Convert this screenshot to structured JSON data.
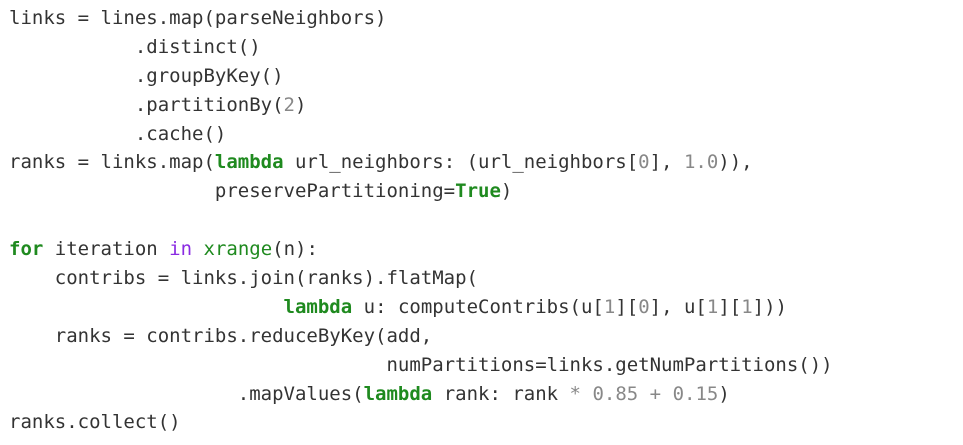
{
  "code": {
    "l1": {
      "a": "links = lines.map(parseNeighbors)"
    },
    "l2": {
      "a": "           .distinct()"
    },
    "l3": {
      "a": "           .groupByKey()"
    },
    "l4": {
      "a": "           .partitionBy(",
      "n": "2",
      "b": ")"
    },
    "l5": {
      "a": "           .cache()"
    },
    "l6": {
      "a": "ranks = links.map(",
      "k": "lambda",
      "b": " url_neighbors: (url_neighbors[",
      "n1": "0",
      "c": "], ",
      "n2": "1.0",
      "d": ")),"
    },
    "l7": {
      "a": "                  preservePartitioning=",
      "k": "True",
      "b": ")"
    },
    "l8": {
      "a": ""
    },
    "l9": {
      "k": "for",
      "a": " iteration ",
      "k2": "in",
      "b": " ",
      "f": "xrange",
      "c": "(n):"
    },
    "l10": {
      "a": "    contribs = links.join(ranks).flatMap("
    },
    "l11": {
      "a": "                        ",
      "k": "lambda",
      "b": " u: computeContribs(u[",
      "n1": "1",
      "c": "][",
      "n2": "0",
      "d": "], u[",
      "n3": "1",
      "e": "][",
      "n4": "1",
      "f": "]))"
    },
    "l12": {
      "a": "    ranks = contribs.reduceByKey(add,"
    },
    "l13": {
      "a": "                                 numPartitions=links.getNumPartitions())"
    },
    "l14": {
      "a": "                    .mapValues(",
      "k": "lambda",
      "b": " rank: rank ",
      "op": "*",
      "c": " ",
      "n1": "0.85",
      "d": " ",
      "op2": "+",
      "e": " ",
      "n2": "0.15",
      "f": ")"
    },
    "l15": {
      "a": "ranks.collect()"
    }
  }
}
